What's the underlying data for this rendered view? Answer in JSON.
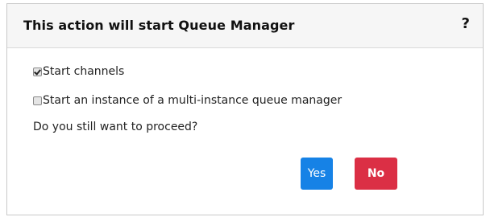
{
  "dialog": {
    "title": "This action will start Queue Manager",
    "help_icon": "?",
    "options": [
      {
        "label": "Start channels",
        "checked": true
      },
      {
        "label": "Start an instance of a multi-instance queue manager",
        "checked": false
      }
    ],
    "question": "Do you still want to proceed?",
    "yes_label": "Yes",
    "no_label": "No"
  },
  "colors": {
    "yes_button": "#1682e6",
    "no_button": "#db2f45",
    "header_bg": "#f6f6f6"
  }
}
